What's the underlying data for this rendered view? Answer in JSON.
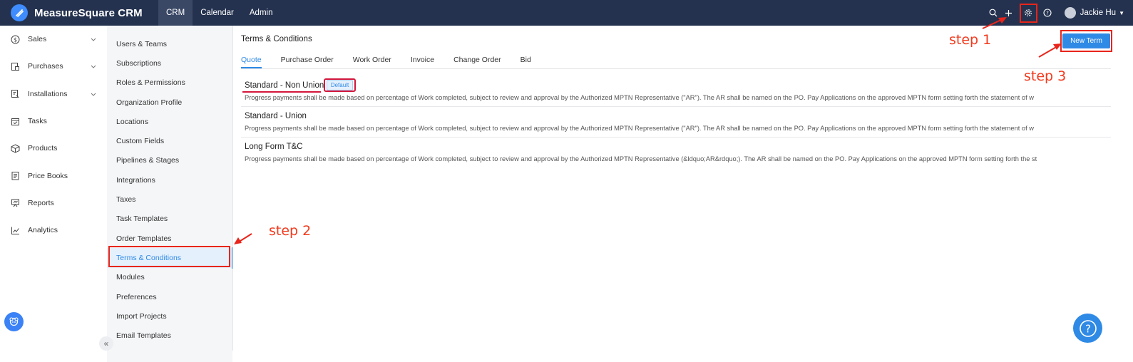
{
  "app": {
    "brand": "MeasureSquare CRM"
  },
  "topnav": {
    "items": [
      "CRM",
      "Calendar",
      "Admin"
    ],
    "active": "CRM"
  },
  "user": {
    "name": "Jackie Hu"
  },
  "sidebar": {
    "items": [
      {
        "label": "Sales",
        "icon": "dollar-icon",
        "expandable": true
      },
      {
        "label": "Purchases",
        "icon": "purchases-icon",
        "expandable": true
      },
      {
        "label": "Installations",
        "icon": "installations-icon",
        "expandable": true
      },
      {
        "label": "Tasks",
        "icon": "tasks-icon",
        "expandable": false
      },
      {
        "label": "Products",
        "icon": "box-icon",
        "expandable": false
      },
      {
        "label": "Price Books",
        "icon": "book-icon",
        "expandable": false
      },
      {
        "label": "Reports",
        "icon": "presentation-icon",
        "expandable": false
      },
      {
        "label": "Analytics",
        "icon": "chart-line-icon",
        "expandable": false
      }
    ]
  },
  "settings_menu": {
    "items": [
      "Users & Teams",
      "Subscriptions",
      "Roles & Permissions",
      "Organization Profile",
      "Locations",
      "Custom Fields",
      "Pipelines & Stages",
      "Integrations",
      "Taxes",
      "Task Templates",
      "Order Templates",
      "Terms & Conditions",
      "Modules",
      "Preferences",
      "Import Projects",
      "Email Templates"
    ],
    "active": "Terms & Conditions"
  },
  "main": {
    "title": "Terms & Conditions",
    "tabs": [
      "Quote",
      "Purchase Order",
      "Work Order",
      "Invoice",
      "Change Order",
      "Bid"
    ],
    "active_tab": "Quote",
    "new_button": "New Term",
    "default_badge": "Default",
    "terms": [
      {
        "title": "Standard - Non Union",
        "description": "Progress payments shall be made based on percentage of Work completed, subject to review and approval by the Authorized MPTN Representative (\"AR\"). The AR shall be named on the PO. Pay Applications on the approved MPTN form setting forth the statement of w"
      },
      {
        "title": "Standard - Union",
        "description": "Progress payments shall be made based on percentage of Work completed, subject to review and approval by the Authorized MPTN Representative (\"AR\"). The AR shall be named on the PO. Pay Applications on the approved MPTN form setting forth the statement of w"
      },
      {
        "title": "Long Form T&C",
        "description": "Progress payments shall be made based on percentage of Work completed, subject to review and approval by the Authorized MPTN Representative (&ldquo;AR&rdquo;). The AR shall be named on the PO. Pay Applications on the approved MPTN form setting forth the st"
      }
    ]
  },
  "annotations": {
    "step1": "step 1",
    "step2": "step 2",
    "step3": "step 3"
  },
  "colors": {
    "topbar": "#24324f",
    "accent": "#2f8ae5",
    "annotation_red": "#e8251b"
  }
}
